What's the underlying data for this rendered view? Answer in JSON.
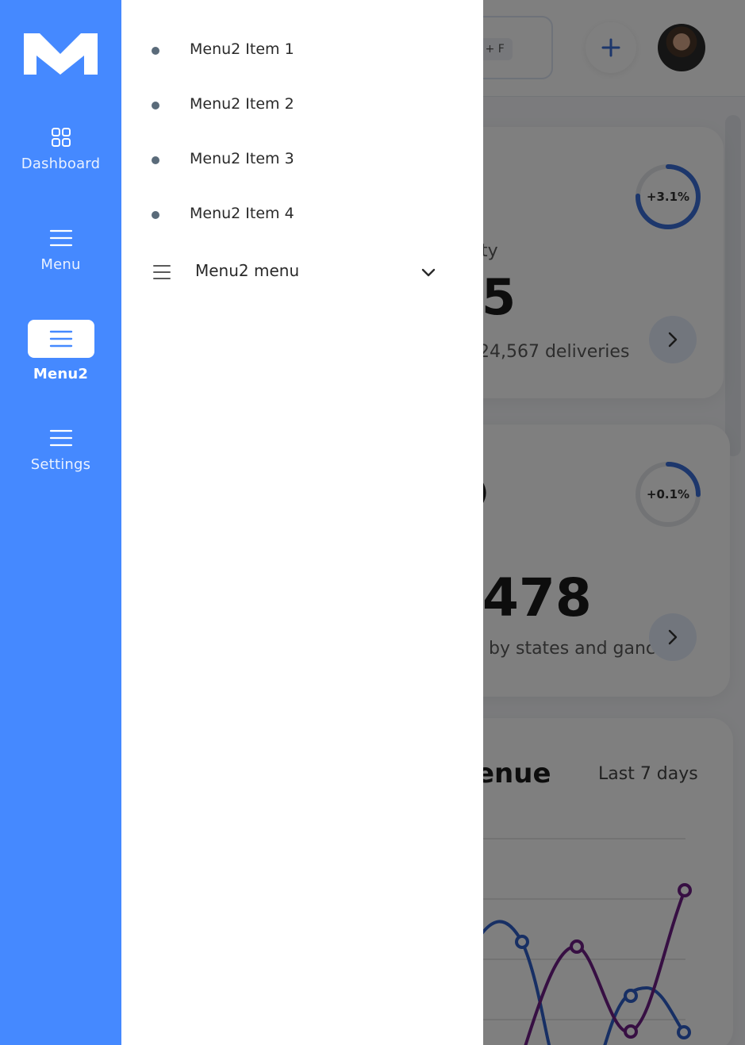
{
  "background": {
    "search_shortcut": "trl + F",
    "card1": {
      "percent": "+3.1%",
      "label_fragment": "ty",
      "value_fragment": "5",
      "sub_fragment": "24,567 deliveries"
    },
    "card2": {
      "percent": "+0.1%",
      "label_fragment": ")",
      "value_fragment": "478",
      "sub_fragment": "by states and ganc"
    },
    "card3": {
      "title_fragment": "enue",
      "range_label": "Last 7 days"
    }
  },
  "rail": {
    "items": [
      {
        "label": "Dashboard",
        "icon": "grid-icon"
      },
      {
        "label": "Menu",
        "icon": "hamburger-icon"
      },
      {
        "label": "Menu2",
        "icon": "hamburger-icon"
      },
      {
        "label": "Settings",
        "icon": "hamburger-icon"
      }
    ],
    "active": "Menu2"
  },
  "drawer": {
    "items": [
      {
        "label": "Menu2 Item 1"
      },
      {
        "label": "Menu2 Item 2"
      },
      {
        "label": "Menu2 Item 3"
      },
      {
        "label": "Menu2 Item 4"
      }
    ],
    "submenu": {
      "label": "Menu2 menu",
      "icon": "hamburger-icon",
      "expand_icon": "chevron-down-icon"
    }
  },
  "colors": {
    "rail_bg": "#4589ff",
    "accent": "#3a6fd8",
    "chart_line_a": "#2f5fc9",
    "chart_line_b": "#6e1f86"
  }
}
